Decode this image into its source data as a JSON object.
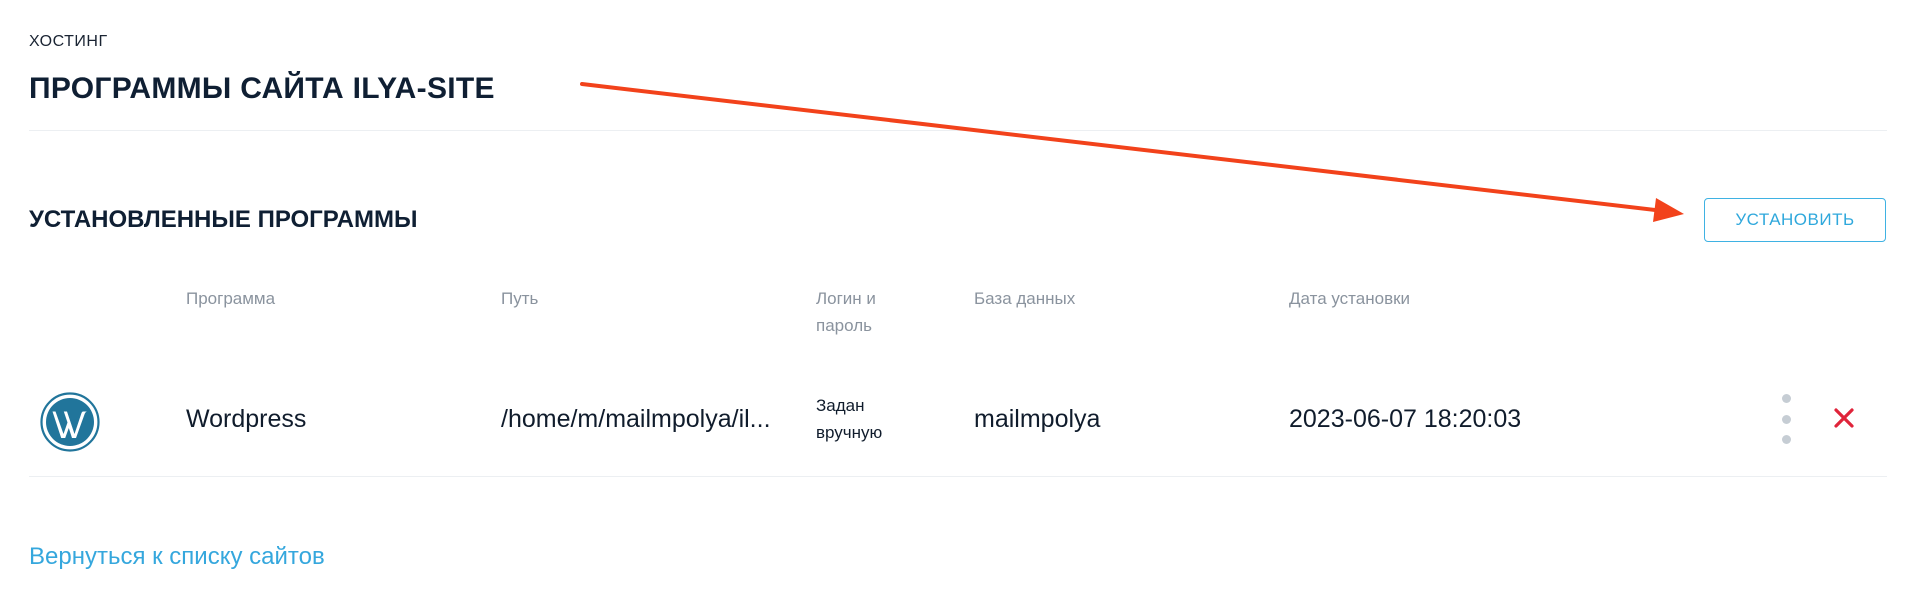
{
  "breadcrumb": "ХОСТИНГ",
  "page_title": "ПРОГРАММЫ САЙТА ILYA-SITE",
  "section": {
    "title": "УСТАНОВЛЕННЫЕ ПРОГРАММЫ",
    "install_label": "УСТАНОВИТЬ"
  },
  "table": {
    "headers": {
      "program": "Программа",
      "path": "Путь",
      "login_line1": "Логин и",
      "login_line2": "пароль",
      "database": "База данных",
      "install_date": "Дата установки"
    },
    "rows": [
      {
        "icon": "wordpress-icon",
        "program": "Wordpress",
        "path": "/home/m/mailmpolya/il...",
        "login_line1": "Задан",
        "login_line2": "вручную",
        "database": "mailmpolya",
        "install_date": "2023-06-07 18:20:03"
      }
    ]
  },
  "back_link": "Вернуться к списку сайтов",
  "colors": {
    "accent": "#35a7dd",
    "delete": "#e0243a",
    "annotation_arrow": "#f2421b",
    "wordpress": "#21759b"
  }
}
